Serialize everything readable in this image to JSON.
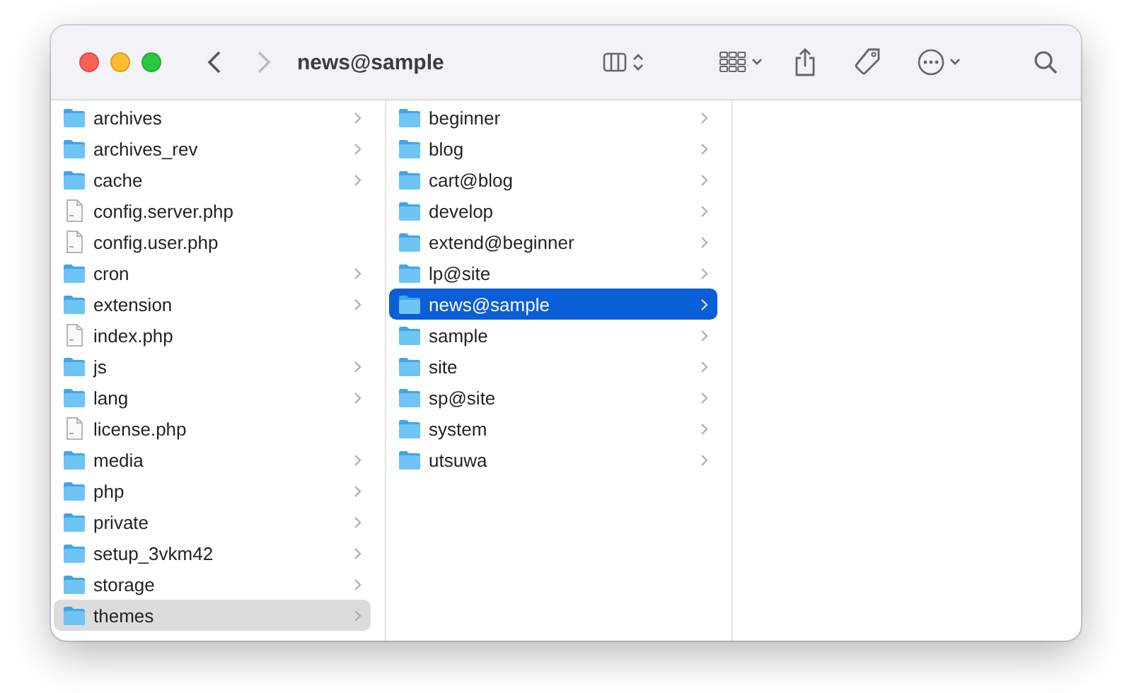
{
  "window": {
    "title": "news@sample"
  },
  "columns": [
    {
      "focused": false,
      "items": [
        {
          "name": "archives",
          "kind": "folder",
          "selected": false
        },
        {
          "name": "archives_rev",
          "kind": "folder",
          "selected": false
        },
        {
          "name": "cache",
          "kind": "folder",
          "selected": false
        },
        {
          "name": "config.server.php",
          "kind": "file",
          "selected": false
        },
        {
          "name": "config.user.php",
          "kind": "file",
          "selected": false
        },
        {
          "name": "cron",
          "kind": "folder",
          "selected": false
        },
        {
          "name": "extension",
          "kind": "folder",
          "selected": false
        },
        {
          "name": "index.php",
          "kind": "file",
          "selected": false
        },
        {
          "name": "js",
          "kind": "folder",
          "selected": false
        },
        {
          "name": "lang",
          "kind": "folder",
          "selected": false
        },
        {
          "name": "license.php",
          "kind": "file",
          "selected": false
        },
        {
          "name": "media",
          "kind": "folder",
          "selected": false
        },
        {
          "name": "php",
          "kind": "folder",
          "selected": false
        },
        {
          "name": "private",
          "kind": "folder",
          "selected": false
        },
        {
          "name": "setup_3vkm42",
          "kind": "folder",
          "selected": false
        },
        {
          "name": "storage",
          "kind": "folder",
          "selected": false
        },
        {
          "name": "themes",
          "kind": "folder",
          "selected": true
        }
      ]
    },
    {
      "focused": true,
      "items": [
        {
          "name": "beginner",
          "kind": "folder",
          "selected": false
        },
        {
          "name": "blog",
          "kind": "folder",
          "selected": false
        },
        {
          "name": "cart@blog",
          "kind": "folder",
          "selected": false
        },
        {
          "name": "develop",
          "kind": "folder",
          "selected": false
        },
        {
          "name": "extend@beginner",
          "kind": "folder",
          "selected": false
        },
        {
          "name": "lp@site",
          "kind": "folder",
          "selected": false
        },
        {
          "name": "news@sample",
          "kind": "folder",
          "selected": true
        },
        {
          "name": "sample",
          "kind": "folder",
          "selected": false
        },
        {
          "name": "site",
          "kind": "folder",
          "selected": false
        },
        {
          "name": "sp@site",
          "kind": "folder",
          "selected": false
        },
        {
          "name": "system",
          "kind": "folder",
          "selected": false
        },
        {
          "name": "utsuwa",
          "kind": "folder",
          "selected": false
        }
      ]
    }
  ]
}
